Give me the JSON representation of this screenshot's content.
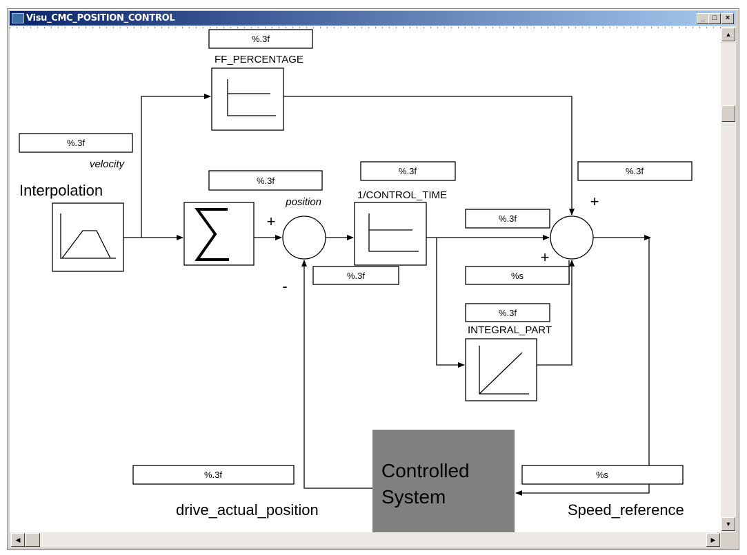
{
  "window": {
    "title": "Visu_CMC_POSITION_CONTROL",
    "icon": "window-app-icon",
    "controls": [
      "minimize",
      "maximize",
      "close"
    ]
  },
  "diagram": {
    "ff_value": "%.3f",
    "ff_label": "FF_PERCENTAGE",
    "velocity_value": "%.3f",
    "velocity_label": "velocity",
    "interpolation_label": "Interpolation",
    "position_value": "%.3f",
    "position_label": "position",
    "sum1_plus": "+",
    "sum1_minus": "-",
    "control_time_value": "%.3f",
    "control_time_label": "1/CONTROL_TIME",
    "error_value": "%.3f",
    "p_part_value": "%.3f",
    "sum2_plus_top": "+",
    "sum2_plus_bottom": "+",
    "status_value": "%s",
    "integral_value": "%.3f",
    "integral_label": "INTEGRAL_PART",
    "output_value": "%.3f",
    "controlled_system_line1": "Controlled",
    "controlled_system_line2": "System",
    "controlled_system_color": "#808080",
    "drive_value": "%.3f",
    "drive_label": "drive_actual_position",
    "speed_value": "%s",
    "speed_label": "Speed_reference"
  }
}
